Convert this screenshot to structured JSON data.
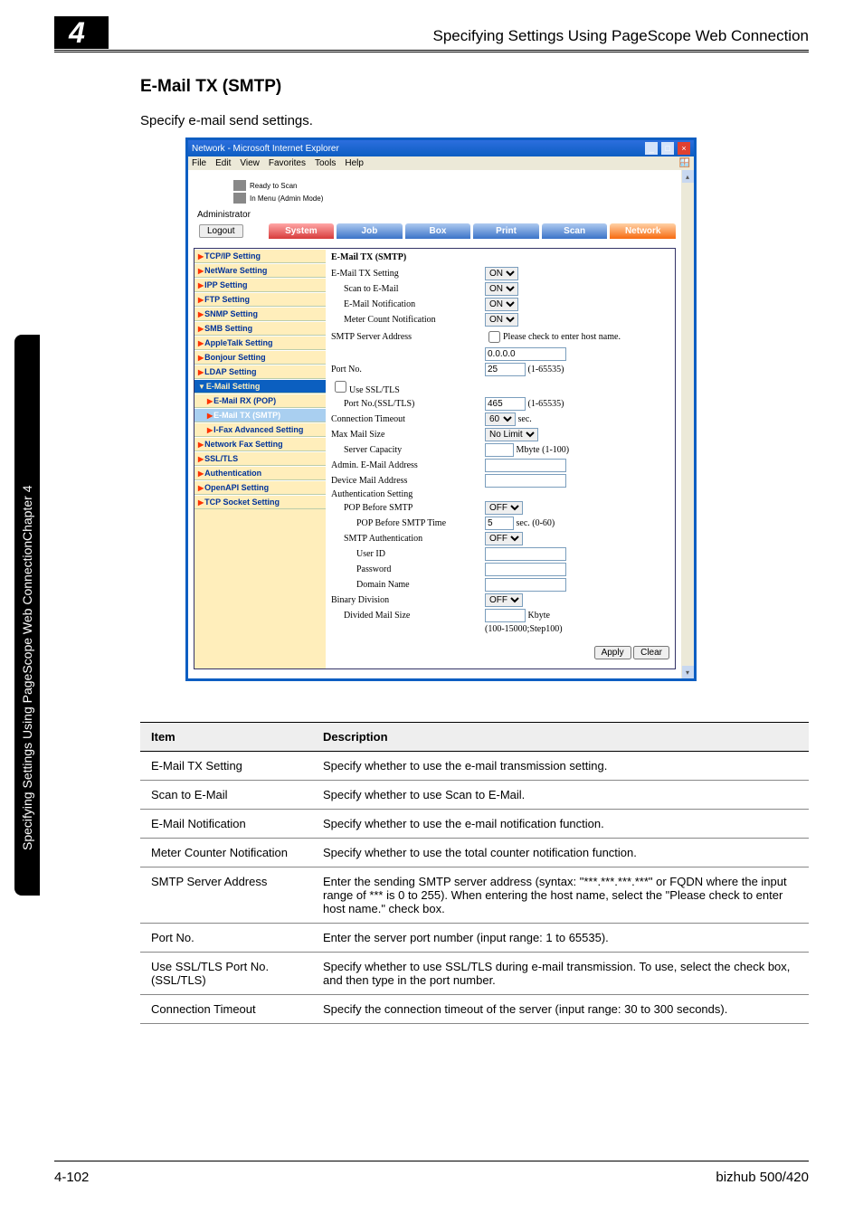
{
  "header": {
    "chapter_tab_chapter": "Chapter 4",
    "chapter_tab_title": "Specifying Settings Using PageScope Web Connection",
    "page_num": "4",
    "title": "Specifying Settings Using PageScope Web Connection"
  },
  "section": {
    "heading": "E-Mail TX (SMTP)",
    "intro": "Specify e-mail send settings."
  },
  "browser": {
    "title": "Network - Microsoft Internet Explorer",
    "menubar": [
      "File",
      "Edit",
      "View",
      "Favorites",
      "Tools",
      "Help"
    ],
    "status1": "Ready to Scan",
    "status2": "In Menu (Admin Mode)",
    "admin": "Administrator",
    "logout": "Logout",
    "tabs": [
      "System",
      "Job",
      "Box",
      "Print",
      "Scan",
      "Network"
    ],
    "nav": [
      {
        "label": "TCP/IP Setting",
        "sub": false,
        "active": false
      },
      {
        "label": "NetWare Setting",
        "sub": false,
        "active": false
      },
      {
        "label": "IPP Setting",
        "sub": false,
        "active": false
      },
      {
        "label": "FTP Setting",
        "sub": false,
        "active": false
      },
      {
        "label": "SNMP Setting",
        "sub": false,
        "active": false
      },
      {
        "label": "SMB Setting",
        "sub": false,
        "active": false
      },
      {
        "label": "AppleTalk Setting",
        "sub": false,
        "active": false
      },
      {
        "label": "Bonjour Setting",
        "sub": false,
        "active": false
      },
      {
        "label": "LDAP Setting",
        "sub": false,
        "active": false
      },
      {
        "label": "E-Mail Setting",
        "sub": false,
        "active": true
      },
      {
        "label": "E-Mail RX (POP)",
        "sub": true,
        "active": false
      },
      {
        "label": "E-Mail TX (SMTP)",
        "sub": true,
        "active": false,
        "highlight": true
      },
      {
        "label": "I-Fax Advanced Setting",
        "sub": true,
        "active": false
      },
      {
        "label": "Network Fax Setting",
        "sub": false,
        "active": false
      },
      {
        "label": "SSL/TLS",
        "sub": false,
        "active": false
      },
      {
        "label": "Authentication",
        "sub": false,
        "active": false
      },
      {
        "label": "OpenAPI Setting",
        "sub": false,
        "active": false
      },
      {
        "label": "TCP Socket Setting",
        "sub": false,
        "active": false
      }
    ],
    "detail": {
      "title": "E-Mail TX (SMTP)",
      "rows": {
        "emailtx": {
          "label": "E-Mail TX Setting",
          "value": "ON"
        },
        "scanto": {
          "label": "Scan to E-Mail",
          "value": "ON"
        },
        "notif": {
          "label": "E-Mail Notification",
          "value": "ON"
        },
        "meter": {
          "label": "Meter Count Notification",
          "value": "ON"
        },
        "server": {
          "label": "SMTP Server Address",
          "check": "Please check to enter host name.",
          "value": "0.0.0.0"
        },
        "port": {
          "label": "Port No.",
          "value": "25",
          "range": "(1-65535)"
        },
        "usessl": {
          "label": "Use SSL/TLS"
        },
        "sslport": {
          "label": "Port No.(SSL/TLS)",
          "value": "465",
          "range": "(1-65535)"
        },
        "timeout": {
          "label": "Connection Timeout",
          "value": "60",
          "unit": "sec."
        },
        "maxmail": {
          "label": "Max Mail Size",
          "value": "No Limit"
        },
        "capacity": {
          "label": "Server Capacity",
          "unit": "Mbyte (1-100)"
        },
        "admin_email": {
          "label": "Admin. E-Mail Address"
        },
        "device_email": {
          "label": "Device Mail Address"
        },
        "auth_setting": {
          "label": "Authentication Setting"
        },
        "pop_before": {
          "label": "POP Before SMTP",
          "value": "OFF"
        },
        "pop_time": {
          "label": "POP Before SMTP Time",
          "value": "5",
          "unit": "sec. (0-60)"
        },
        "smtp_auth": {
          "label": "SMTP Authentication",
          "value": "OFF"
        },
        "userid": {
          "label": "User ID"
        },
        "password": {
          "label": "Password"
        },
        "domain": {
          "label": "Domain Name"
        },
        "binary": {
          "label": "Binary Division",
          "value": "OFF"
        },
        "divided": {
          "label": "Divided Mail Size",
          "unit": "Kbyte",
          "range": "(100-15000;Step100)"
        }
      },
      "apply": "Apply",
      "clear": "Clear"
    }
  },
  "table": {
    "h1": "Item",
    "h2": "Description",
    "rows": [
      {
        "item": "E-Mail TX Setting",
        "desc": "Specify whether to use the e-mail transmission setting."
      },
      {
        "item": "Scan to E-Mail",
        "desc": "Specify whether to use Scan to E-Mail."
      },
      {
        "item": "E-Mail Notification",
        "desc": "Specify whether to use the e-mail notification function."
      },
      {
        "item": "Meter Counter Notification",
        "desc": "Specify whether to use the total counter notification function."
      },
      {
        "item": "SMTP Server Address",
        "desc": "Enter the sending SMTP server address (syntax: \"***.***.***.***\" or FQDN where the input range of *** is 0 to 255). When entering the host name, select the \"Please check to enter host name.\" check box."
      },
      {
        "item": "Port No.",
        "desc": "Enter the server port number (input range: 1 to 65535)."
      },
      {
        "item": "Use SSL/TLS Port No. (SSL/TLS)",
        "desc": "Specify whether to use SSL/TLS during e-mail transmission. To use, select the check box, and then type in the port number."
      },
      {
        "item": "Connection Timeout",
        "desc": "Specify the connection timeout of the server (input range: 30 to 300 seconds)."
      }
    ]
  },
  "footer": {
    "left": "4-102",
    "right": "bizhub 500/420"
  }
}
